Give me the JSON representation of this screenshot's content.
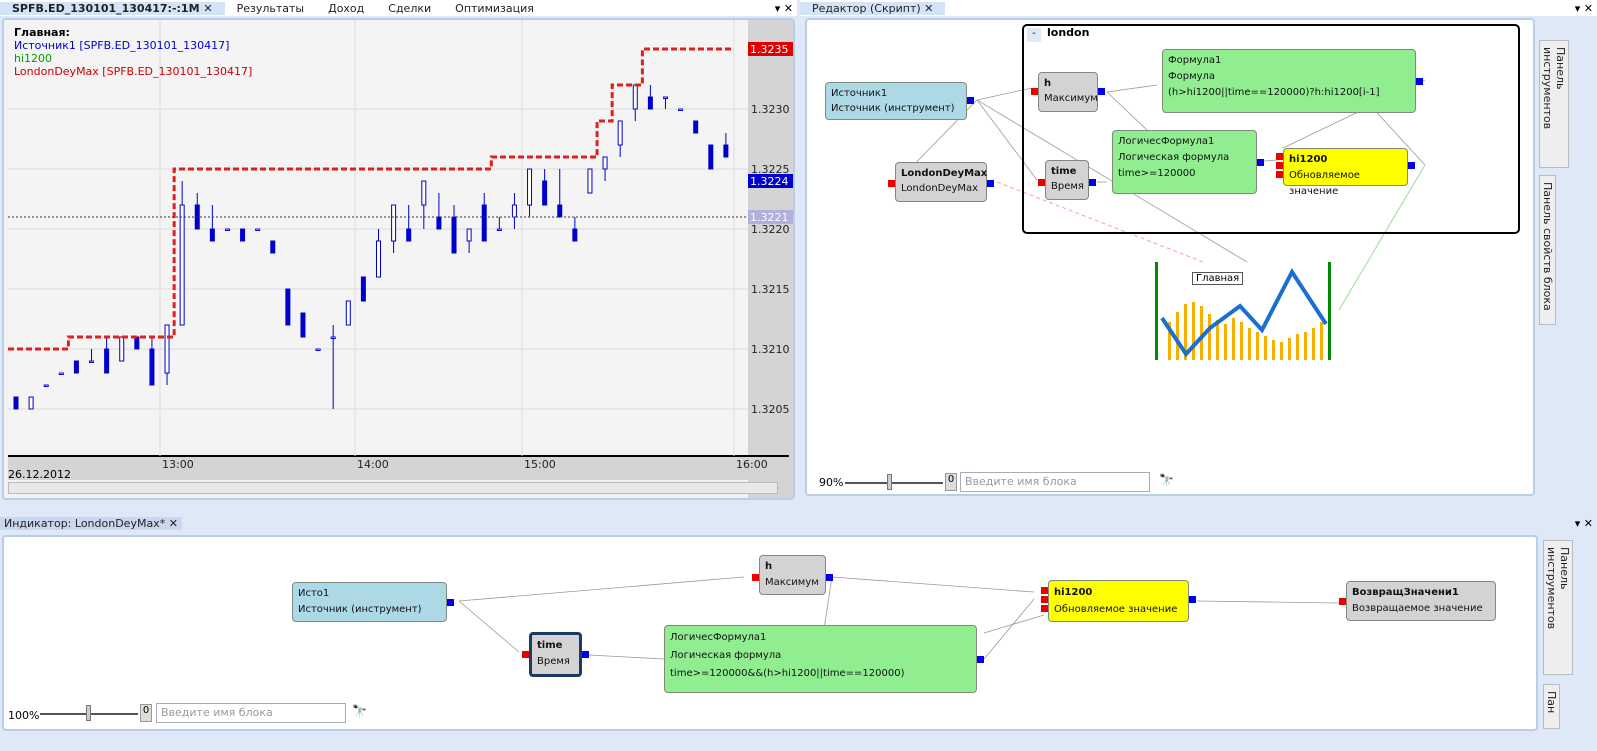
{
  "top_left": {
    "tabs": [
      "SPFB.ED_130101_130417:-:1M",
      "Результаты",
      "Доход",
      "Сделки",
      "Оптимизация"
    ],
    "legend": {
      "title": "Главная:",
      "items": [
        {
          "text": "Источник1 [SPFB.ED_130101_130417]",
          "color": "#0000cc"
        },
        {
          "text": "hi1200",
          "color": "#00a000"
        },
        {
          "text": "LondonDeyMax [SPFB.ED_130101_130417]",
          "color": "#cc0000"
        }
      ]
    },
    "price_ticks": [
      "1.3205",
      "1.3210",
      "1.3215",
      "1.3220",
      "1.3225",
      "1.3230"
    ],
    "price_labels": {
      "last_max": "1.3235",
      "last_price": "1.3224",
      "cursor": "1.3221"
    },
    "time_ticks": [
      "13:00",
      "14:00",
      "15:00",
      "16:00"
    ],
    "date": "26.12.2012"
  },
  "chart_data": {
    "type": "candlestick",
    "ylim": [
      1.3202,
      1.3238
    ],
    "candles": [
      [
        1.3206,
        1.3206,
        1.3205,
        1.3205
      ],
      [
        1.3205,
        1.3206,
        1.3205,
        1.3206
      ],
      [
        1.3207,
        1.3207,
        1.3207,
        1.3207
      ],
      [
        1.3208,
        1.3208,
        1.3208,
        1.3208
      ],
      [
        1.3209,
        1.3209,
        1.3208,
        1.3208
      ],
      [
        1.3209,
        1.321,
        1.3209,
        1.3209
      ],
      [
        1.321,
        1.3211,
        1.3208,
        1.3208
      ],
      [
        1.3209,
        1.3211,
        1.3209,
        1.3211
      ],
      [
        1.3211,
        1.3211,
        1.321,
        1.321
      ],
      [
        1.321,
        1.3211,
        1.3207,
        1.3207
      ],
      [
        1.3208,
        1.3212,
        1.3207,
        1.3212
      ],
      [
        1.3212,
        1.3224,
        1.3212,
        1.3222
      ],
      [
        1.3222,
        1.3223,
        1.322,
        1.322
      ],
      [
        1.322,
        1.3222,
        1.3219,
        1.3219
      ],
      [
        1.322,
        1.322,
        1.322,
        1.322
      ],
      [
        1.322,
        1.322,
        1.3219,
        1.3219
      ],
      [
        1.322,
        1.322,
        1.322,
        1.322
      ],
      [
        1.3219,
        1.3219,
        1.3218,
        1.3218
      ],
      [
        1.3215,
        1.3215,
        1.3212,
        1.3212
      ],
      [
        1.3213,
        1.3213,
        1.3211,
        1.3211
      ],
      [
        1.321,
        1.321,
        1.321,
        1.321
      ],
      [
        1.3211,
        1.3212,
        1.3205,
        1.3211
      ],
      [
        1.3212,
        1.3214,
        1.3212,
        1.3214
      ],
      [
        1.3216,
        1.3216,
        1.3214,
        1.3214
      ],
      [
        1.3216,
        1.322,
        1.3216,
        1.3219
      ],
      [
        1.3219,
        1.3222,
        1.3218,
        1.3222
      ],
      [
        1.322,
        1.3222,
        1.3219,
        1.3219
      ],
      [
        1.3222,
        1.3224,
        1.322,
        1.3224
      ],
      [
        1.3221,
        1.3223,
        1.322,
        1.322
      ],
      [
        1.3221,
        1.3222,
        1.3218,
        1.3218
      ],
      [
        1.3219,
        1.322,
        1.3218,
        1.322
      ],
      [
        1.3222,
        1.3223,
        1.3219,
        1.3219
      ],
      [
        1.322,
        1.3221,
        1.322,
        1.322
      ],
      [
        1.3221,
        1.3223,
        1.322,
        1.3222
      ],
      [
        1.3222,
        1.3225,
        1.3221,
        1.3225
      ],
      [
        1.3224,
        1.3225,
        1.3222,
        1.3222
      ],
      [
        1.3222,
        1.3225,
        1.3221,
        1.3221
      ],
      [
        1.322,
        1.3221,
        1.3219,
        1.3219
      ],
      [
        1.3223,
        1.3225,
        1.3223,
        1.3225
      ],
      [
        1.3225,
        1.3226,
        1.3224,
        1.3226
      ],
      [
        1.3227,
        1.3229,
        1.3226,
        1.3229
      ],
      [
        1.323,
        1.3232,
        1.3229,
        1.3232
      ],
      [
        1.3231,
        1.3232,
        1.323,
        1.323
      ],
      [
        1.3231,
        1.3231,
        1.323,
        1.3231
      ],
      [
        1.323,
        1.323,
        1.323,
        1.323
      ],
      [
        1.3229,
        1.3229,
        1.3228,
        1.3228
      ],
      [
        1.3227,
        1.3227,
        1.3225,
        1.3225
      ],
      [
        1.3227,
        1.3228,
        1.3226,
        1.3226
      ]
    ],
    "overlay_line": {
      "name": "LondonDeyMax",
      "color": "#e02020",
      "steps": [
        1.321,
        1.321,
        1.321,
        1.321,
        1.3211,
        1.3211,
        1.3211,
        1.3211,
        1.3211,
        1.3211,
        1.3211,
        1.3225,
        1.3225,
        1.3225,
        1.3225,
        1.3225,
        1.3225,
        1.3225,
        1.3225,
        1.3225,
        1.3225,
        1.3225,
        1.3225,
        1.3225,
        1.3225,
        1.3225,
        1.3225,
        1.3225,
        1.3225,
        1.3225,
        1.3225,
        1.3225,
        1.3226,
        1.3226,
        1.3226,
        1.3226,
        1.3226,
        1.3226,
        1.3226,
        1.3229,
        1.3232,
        1.3232,
        1.3235,
        1.3235,
        1.3235,
        1.3235,
        1.3235,
        1.3235
      ]
    }
  },
  "editor": {
    "tab": "Редактор (Скрипт)",
    "group": "london",
    "group_toggle": "-",
    "blocks": {
      "src_title": "Источник1",
      "src_sub": "Источник (инструмент)",
      "ldm_title": "LondonDeyMax",
      "ldm_sub": "LondonDeyMax",
      "h_title": "h",
      "h_sub": "Максимум",
      "time_title": "time",
      "time_sub": "Время",
      "f_title": "Формула1",
      "f_sub": "Формула",
      "f_expr": "(h>hi1200||time==120000)?h:hi1200[i-1]",
      "lf_title": "ЛогичесФормула1",
      "lf_sub": "Логическая формула",
      "lf_expr": "time>=120000",
      "hi_title": "hi1200",
      "hi_sub": "Обновляемое значение",
      "chart_label": "Главная"
    },
    "zoom": "90%",
    "zoom_value": "0",
    "search_placeholder": "Введите имя блока",
    "side_tabs": [
      "Панель инструментов",
      "Панель свойств блока"
    ]
  },
  "bottom": {
    "tab": "Индикатор: LondonDeyMax*",
    "blocks": {
      "src_title": "Исто1",
      "src_sub": "Источник (инструмент)",
      "h_title": "h",
      "h_sub": "Максимум",
      "time_title": "time",
      "time_sub": "Время",
      "lf_title": "ЛогичесФормула1",
      "lf_sub": "Логическая формула",
      "lf_expr": "time>=120000&&(h>hi1200||time==120000)",
      "hi_title": "hi1200",
      "hi_sub": "Обновляемое значение",
      "ret_title": "ВозвращЗначени1",
      "ret_sub": "Возвращаемое значение"
    },
    "zoom": "100%",
    "zoom_value": "0",
    "search_placeholder": "Введите имя блока",
    "side_tabs": [
      "Панель инструментов",
      "Пан"
    ]
  }
}
